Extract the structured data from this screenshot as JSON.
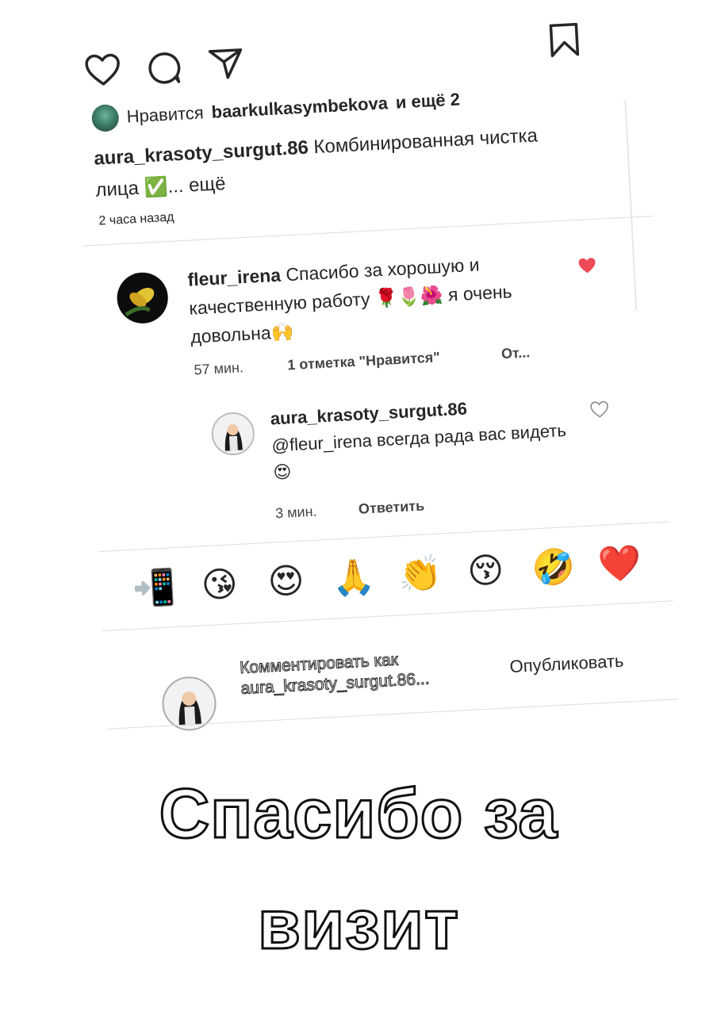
{
  "post": {
    "likes": {
      "prefix": "Нравится",
      "user": "baarkulkasymbekova",
      "suffix": "и ещё 2"
    },
    "caption": {
      "user": "aura_krasoty_surgut.86",
      "text": "Комбинированная чистка лица ✅... ещё"
    },
    "time": "2 часа назад"
  },
  "comments": [
    {
      "user": "fleur_irena",
      "text": "Спасибо за хорошую и качественную работу 🌹🌷🌺 я очень довольна🙌",
      "time": "57 мин.",
      "likes": "1 отметка \"Нравится\"",
      "reply_label": "От..."
    }
  ],
  "reply": {
    "user": "aura_krasoty_surgut.86",
    "text": "@fleur_irena всегда рада вас видеть 😍",
    "time": "3 мин.",
    "reply_label": "Ответить"
  },
  "emoji_bar": [
    "📲",
    "😘",
    "😍",
    "🙏",
    "👏",
    "😚",
    "🤣",
    "❤️"
  ],
  "composer": {
    "placeholder": "Комментировать как aura_krasoty_surgut.86...",
    "publish_label": "Опубликовать"
  },
  "overlay": {
    "line1": "Спасибо за",
    "line2": "визит"
  },
  "colors": {
    "like_red": "#ed4956",
    "text": "#262626"
  },
  "icons": [
    "heart-icon",
    "comment-icon",
    "share-icon",
    "bookmark-icon"
  ]
}
